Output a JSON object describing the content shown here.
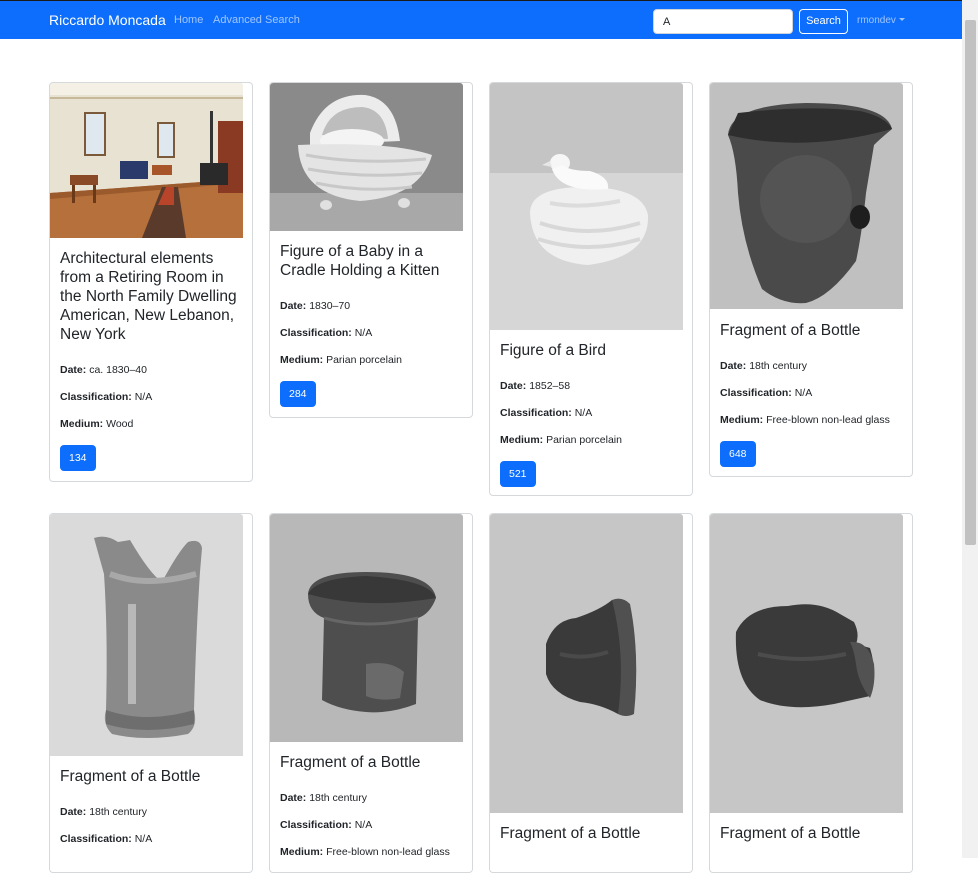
{
  "navbar": {
    "brand": "Riccardo Moncada",
    "links": [
      "Home",
      "Advanced Search"
    ],
    "search_value": "A",
    "search_button": "Search",
    "user": "rmondev"
  },
  "labels": {
    "date": "Date:",
    "classification": "Classification:",
    "medium": "Medium:"
  },
  "cards": [
    {
      "title": "Architectural elements from a Retiring Room in the North Family Dwelling American, New Lebanon, New York",
      "date": "ca. 1830–40",
      "classification": "N/A",
      "medium": "Wood",
      "id": "134"
    },
    {
      "title": "Figure of a Baby in a Cradle Holding a Kitten",
      "date": "1830–70",
      "classification": "N/A",
      "medium": "Parian porcelain",
      "id": "284"
    },
    {
      "title": "Figure of a Bird",
      "date": "1852–58",
      "classification": "N/A",
      "medium": "Parian porcelain",
      "id": "521"
    },
    {
      "title": "Fragment of a Bottle",
      "date": "18th century",
      "classification": "N/A",
      "medium": "Free-blown non-lead glass",
      "id": "648"
    },
    {
      "title": "Fragment of a Bottle",
      "date": "18th century",
      "classification": "N/A"
    },
    {
      "title": "Fragment of a Bottle",
      "date": "18th century",
      "classification": "N/A",
      "medium": "Free-blown non-lead glass"
    },
    {
      "title": "Fragment of a Bottle"
    },
    {
      "title": "Fragment of a Bottle"
    }
  ],
  "colors": {
    "primary": "#0d6efd",
    "card_border": "#d6d9dc"
  }
}
